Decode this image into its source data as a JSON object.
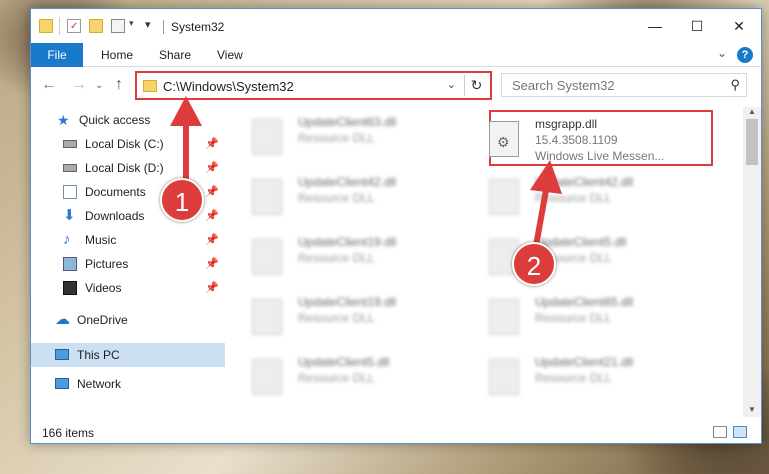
{
  "window": {
    "title": "System32"
  },
  "titlebar": {
    "minimize_glyph": "—",
    "maximize_glyph": "☐",
    "close_glyph": "✕"
  },
  "ribbon": {
    "tabs": [
      {
        "label": "File"
      },
      {
        "label": "Home"
      },
      {
        "label": "Share"
      },
      {
        "label": "View"
      }
    ],
    "help_glyph": "?"
  },
  "address": {
    "path": "C:\\Windows\\System32",
    "refresh_glyph": "↻"
  },
  "search": {
    "placeholder": "Search System32"
  },
  "navpane": {
    "items": [
      {
        "label": "Quick access",
        "icon": "star-icon"
      },
      {
        "label": "Local Disk (C:)",
        "icon": "drive-icon",
        "pinned": true
      },
      {
        "label": "Local Disk (D:)",
        "icon": "drive-icon",
        "pinned": true
      },
      {
        "label": "Documents",
        "icon": "documents-icon",
        "pinned": true
      },
      {
        "label": "Downloads",
        "icon": "download-icon",
        "pinned": true
      },
      {
        "label": "Music",
        "icon": "music-icon",
        "pinned": true
      },
      {
        "label": "Pictures",
        "icon": "pictures-icon",
        "pinned": true
      },
      {
        "label": "Videos",
        "icon": "videos-icon",
        "pinned": true
      },
      {
        "label": "OneDrive",
        "icon": "cloud-icon"
      },
      {
        "label": "This PC",
        "icon": "computer-icon",
        "selected": true
      },
      {
        "label": "Network",
        "icon": "network-icon"
      }
    ]
  },
  "files": {
    "highlighted": {
      "name": "msgrapp.dll",
      "version": "15.4.3508.1109",
      "description": "Windows Live Messen..."
    },
    "left_column": [
      {
        "name": "UpdateClient63.dll",
        "type": "Resource DLL"
      },
      {
        "name": "UpdateClient42.dll",
        "type": "Resource DLL"
      },
      {
        "name": "UpdateClient19.dll",
        "type": "Resource DLL"
      },
      {
        "name": "UpdateClient19.dll",
        "type": "Resource DLL"
      },
      {
        "name": "UpdateClient5.dll",
        "type": "Resource DLL"
      }
    ],
    "right_column": [
      {
        "name": "UpdateClient42.dll",
        "type": "Resource DLL"
      },
      {
        "name": "UpdateClient5.dll",
        "type": "Resource DLL"
      },
      {
        "name": "UpdateClient65.dll",
        "type": "Resource DLL"
      },
      {
        "name": "UpdateClient21.dll",
        "type": "Resource DLL"
      }
    ]
  },
  "status": {
    "item_count": "166 items"
  },
  "annotations": {
    "step1": "1",
    "step2": "2",
    "color": "#dd3c3c"
  },
  "colors": {
    "accent": "#1979ca",
    "selection": "#cce0f3",
    "highlight_border": "#dd3c3c"
  }
}
